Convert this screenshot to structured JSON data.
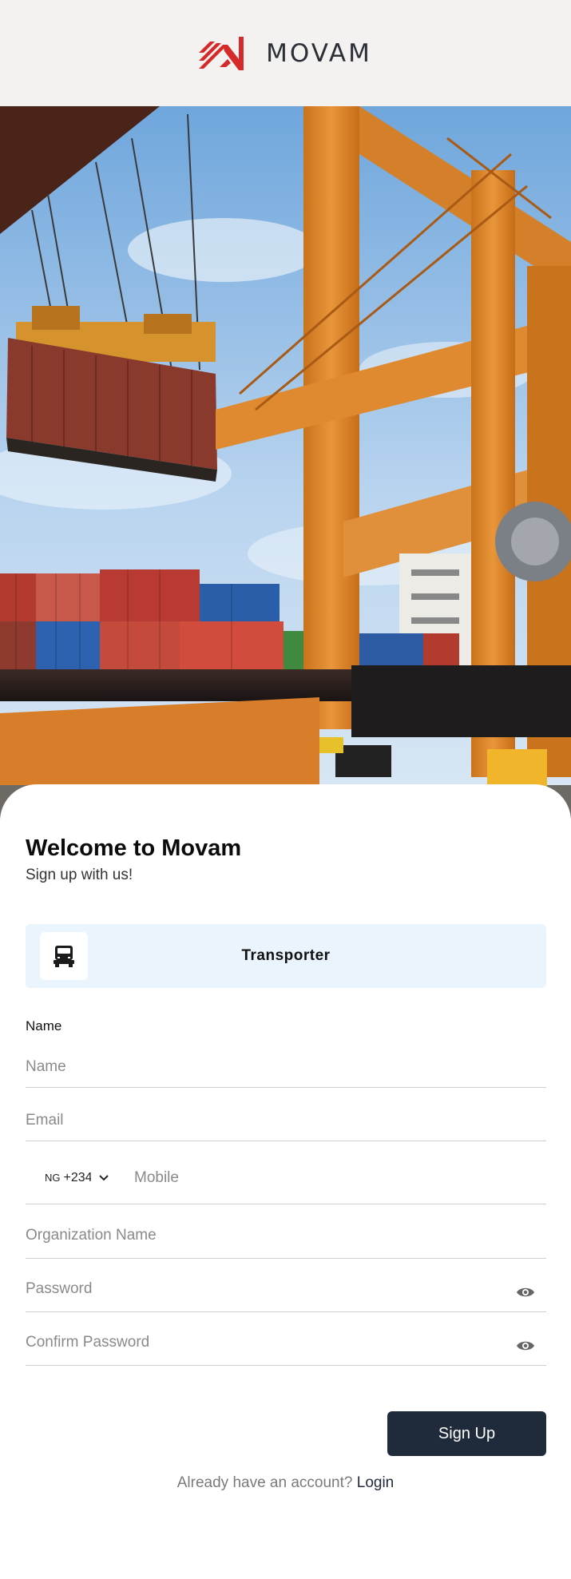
{
  "brand": {
    "name": "MOVAM",
    "logo_icon": "movam-logo-icon",
    "accent": "#d62a2a"
  },
  "hero": {
    "image": "port-cranes-containers-photo"
  },
  "welcome": {
    "title": "Welcome to Movam",
    "subtitle": "Sign up with us!"
  },
  "role": {
    "label": "Transporter",
    "icon": "truck-icon"
  },
  "form": {
    "name_caption": "Name",
    "name_placeholder": "Name",
    "email_placeholder": "Email",
    "country_code": "NG",
    "dial_code": "+234",
    "mobile_placeholder": "Mobile",
    "org_placeholder": "Organization Name",
    "password_placeholder": "Password",
    "confirm_password_placeholder": "Confirm Password"
  },
  "actions": {
    "signup_label": "Sign Up",
    "login_prompt": "Already have an account?",
    "login_label": "Login"
  },
  "colors": {
    "button": "#1f2a3b",
    "role_card_bg": "#eaf4fd",
    "header_bg": "#f3f2f1"
  }
}
